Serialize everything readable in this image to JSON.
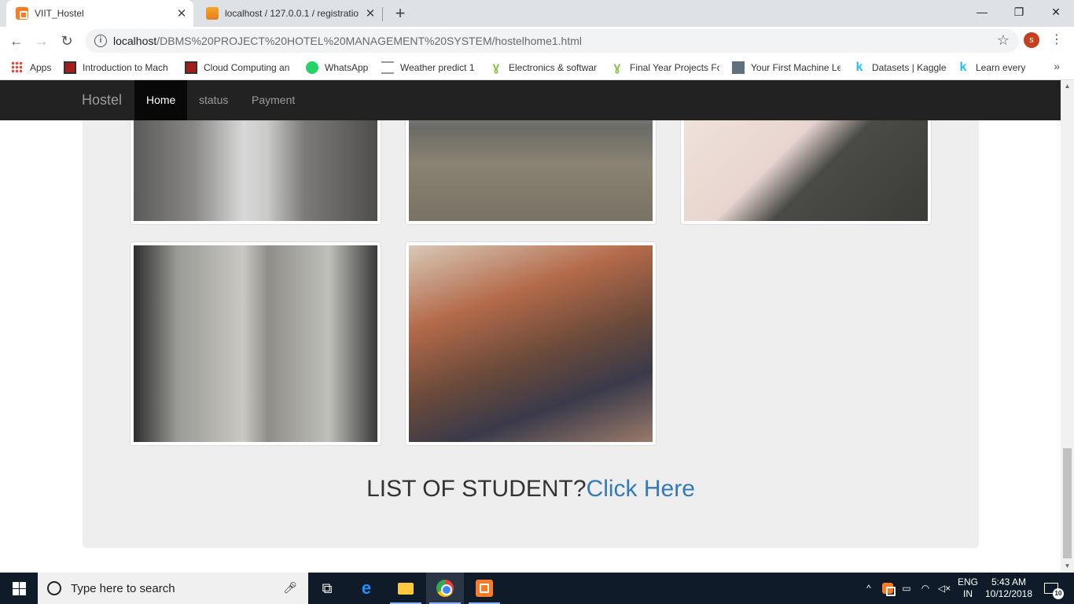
{
  "browser": {
    "tabs": [
      {
        "title": "VIIT_Hostel",
        "icon": "xampp-icon"
      },
      {
        "title": "localhost / 127.0.0.1 / registratio",
        "icon": "phpmyadmin-icon"
      }
    ],
    "new_tab": "+",
    "window_controls": {
      "minimize": "—",
      "restore": "❐",
      "close": "✕"
    },
    "address": {
      "host": "localhost",
      "path": "/DBMS%20PROJECT%20HOTEL%20MANAGEMENT%20SYSTEM/hostelhome1.html"
    },
    "profile_initial": "s",
    "bookmarks": [
      {
        "label": "Apps",
        "icon": "apps-icon"
      },
      {
        "label": "Introduction to Mach",
        "icon": "oq-icon"
      },
      {
        "label": "Cloud Computing an",
        "icon": "oq-icon"
      },
      {
        "label": "WhatsApp",
        "icon": "whatsapp-icon"
      },
      {
        "label": "Weather predict 1",
        "icon": "doc-icon"
      },
      {
        "label": "Electronics & softwar",
        "icon": "leaf-icon"
      },
      {
        "label": "Final Year Projects Fo",
        "icon": "leaf-icon"
      },
      {
        "label": "Your First Machine Le",
        "icon": "person-icon"
      },
      {
        "label": "Datasets | Kaggle",
        "icon": "kaggle-icon"
      },
      {
        "label": "Learn every",
        "icon": "kaggle-icon"
      }
    ],
    "bookmarks_more": "»"
  },
  "site": {
    "brand": "Hostel",
    "nav": [
      {
        "label": "Home",
        "active": true
      },
      {
        "label": "status",
        "active": false
      },
      {
        "label": "Payment",
        "active": false
      }
    ],
    "gallery": [
      {
        "name": "hostel-corridor-photo"
      },
      {
        "name": "hostel-ground-photo"
      },
      {
        "name": "mess-table-photo"
      },
      {
        "name": "dining-hall-photo"
      },
      {
        "name": "canteen-students-photo"
      }
    ],
    "list_prompt": "LIST OF STUDENT?",
    "list_link": "Click Here",
    "link_color": "#337ab7"
  },
  "taskbar": {
    "search_placeholder": "Type here to search",
    "language": {
      "line1": "ENG",
      "line2": "IN"
    },
    "time": "5:43 AM",
    "date": "10/12/2018",
    "notification_count": "10"
  }
}
